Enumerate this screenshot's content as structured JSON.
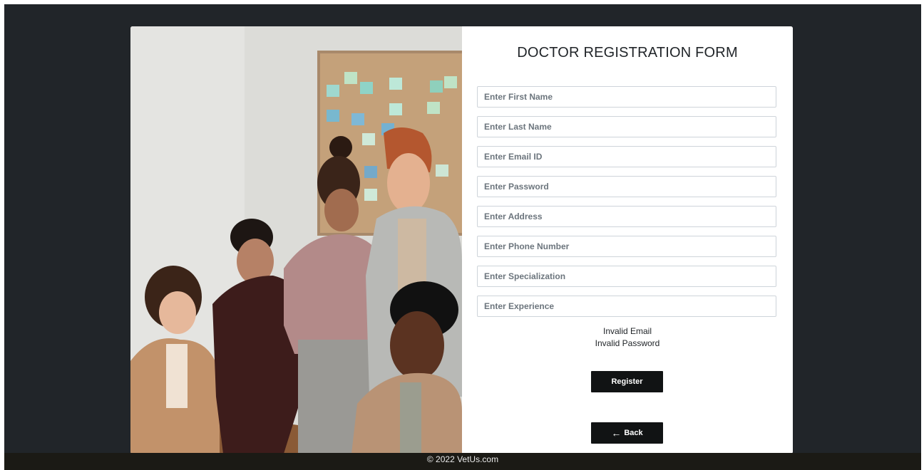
{
  "form": {
    "title": "DOCTOR REGISTRATION FORM",
    "fields": [
      {
        "placeholder": "Enter First Name"
      },
      {
        "placeholder": "Enter Last Name"
      },
      {
        "placeholder": "Enter Email ID"
      },
      {
        "placeholder": "Enter Password"
      },
      {
        "placeholder": "Enter Address"
      },
      {
        "placeholder": "Enter Phone Number"
      },
      {
        "placeholder": "Enter Specialization"
      },
      {
        "placeholder": "Enter Experience"
      }
    ],
    "errors": {
      "email": "Invalid Email",
      "password": "Invalid Password"
    },
    "register_label": "Register",
    "back_label": "Back",
    "back_icon": "left-arrow-icon"
  },
  "footer": {
    "text": "© 2022 VetUs.com"
  },
  "colors": {
    "page_background": "#212529",
    "button": "#111314",
    "footer": "#1b1a15"
  }
}
